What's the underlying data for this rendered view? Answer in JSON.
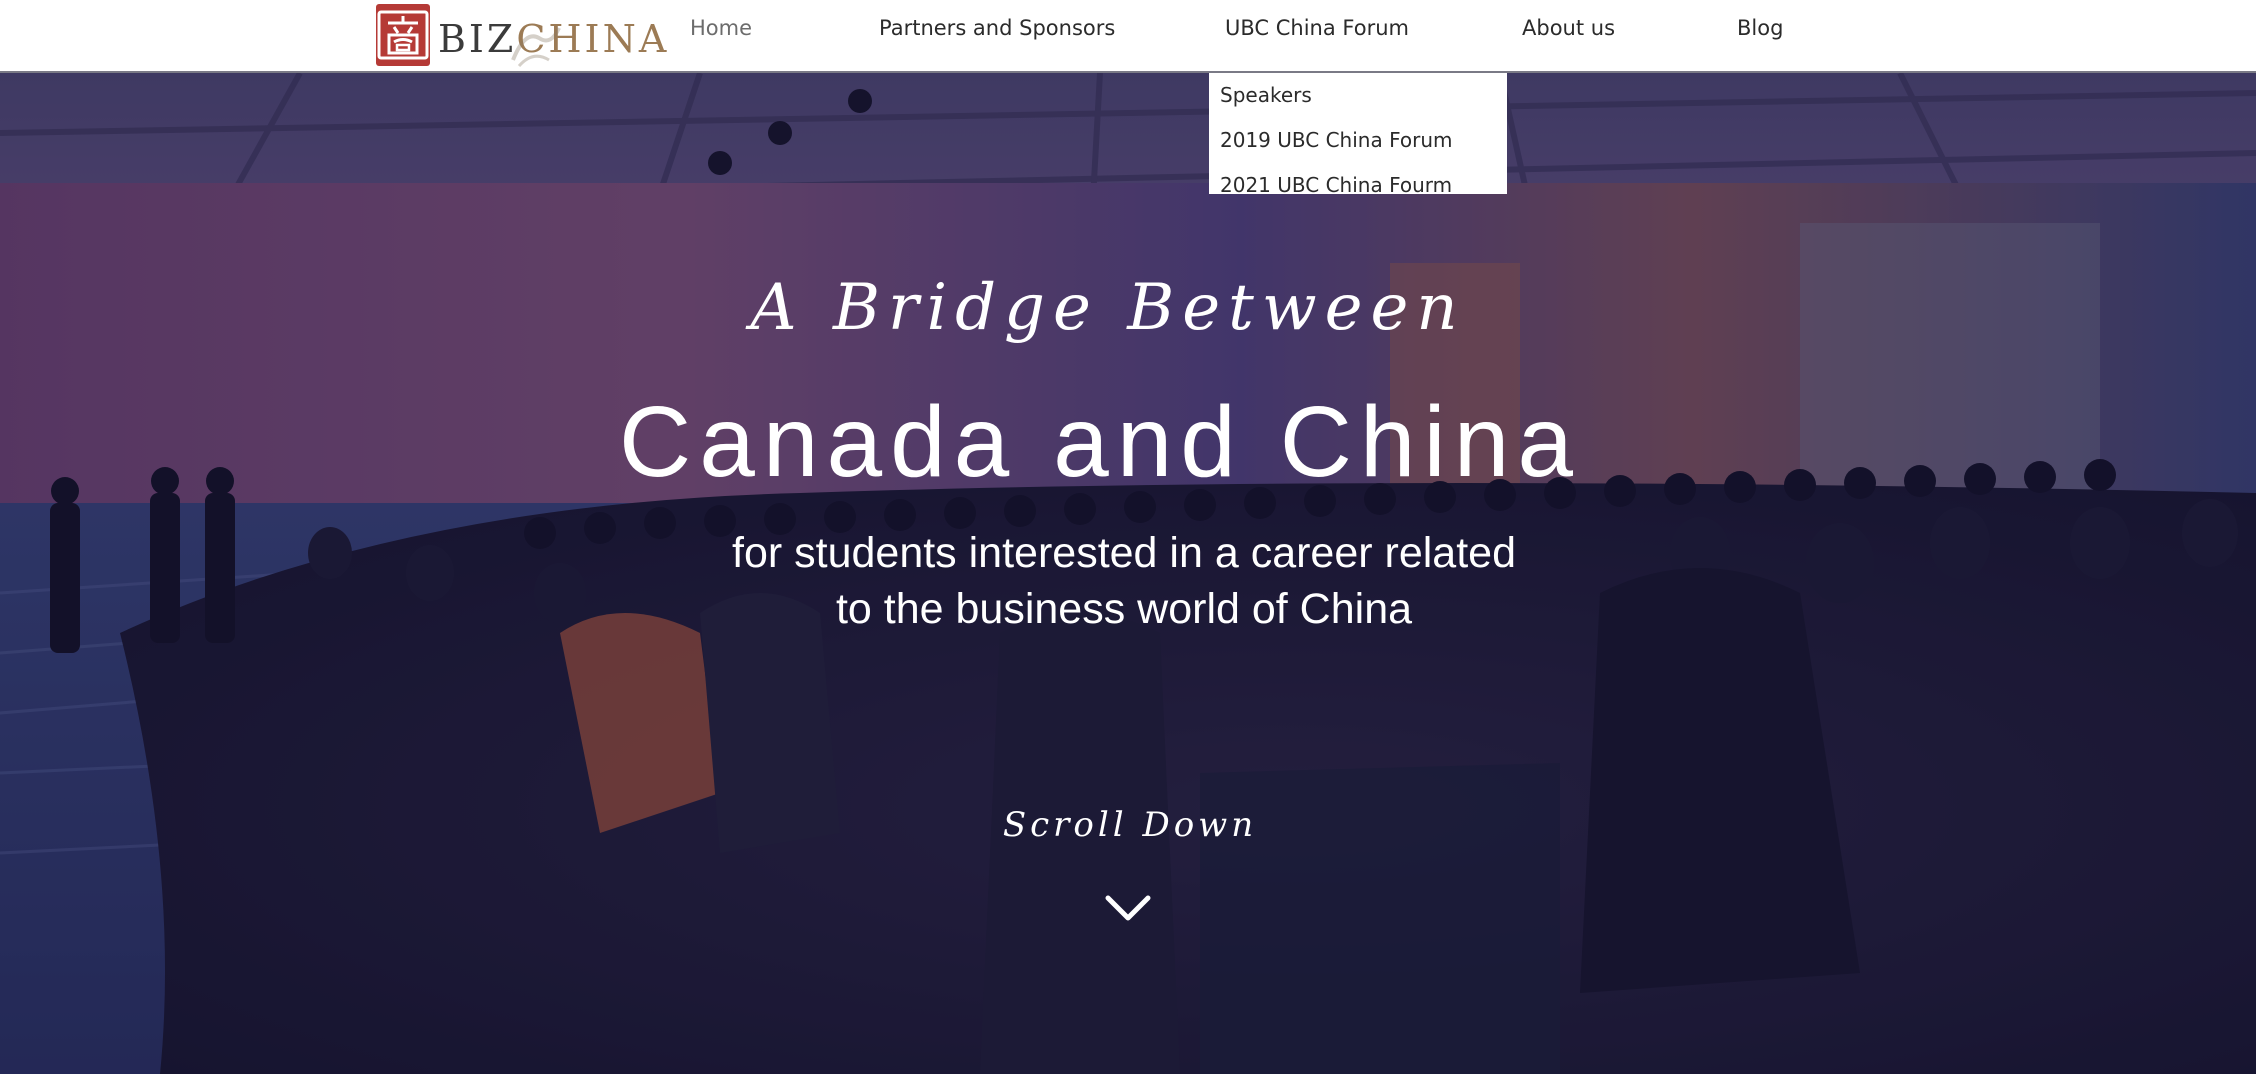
{
  "brand": {
    "logo_text_biz": "BIZ",
    "logo_text_china": "CHINA",
    "seal_color": "#b53a36",
    "accent_color": "#9c7b55"
  },
  "nav": {
    "items": [
      {
        "label": "Home"
      },
      {
        "label": "Partners and Sponsors"
      },
      {
        "label": "UBC China Forum"
      },
      {
        "label": "About us"
      },
      {
        "label": "Blog"
      }
    ],
    "dropdown": {
      "parent": "UBC China Forum",
      "items": [
        {
          "label": "Speakers"
        },
        {
          "label": "2019 UBC China Forum"
        },
        {
          "label": "2021 UBC China Fourm"
        }
      ]
    }
  },
  "hero": {
    "tagline": "A Bridge Between",
    "headline": "Canada and China",
    "subline_1": "for students interested in a career related",
    "subline_2": "to the business world of China",
    "scroll_label": "Scroll Down",
    "scroll_icon": "chevron-down-icon"
  }
}
